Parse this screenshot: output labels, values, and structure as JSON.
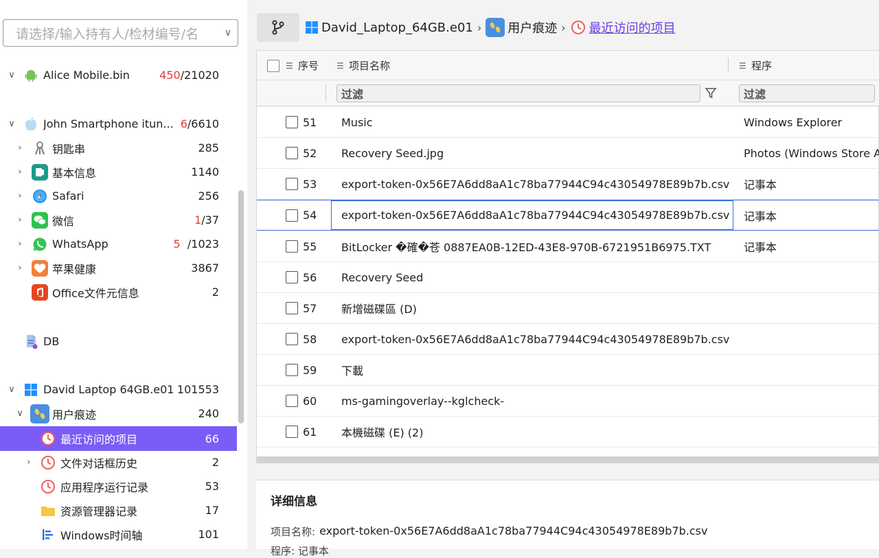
{
  "sidebar": {
    "owner_select_placeholder": "请选择/输入持有人/检材编号/名",
    "nodes": [
      {
        "label": "Alice Mobile.bin",
        "count_red": "450",
        "count_rest": "/21020"
      },
      {
        "label": "John Smartphone itun...",
        "count_red": "6",
        "count_rest": "/6610"
      },
      {
        "label": "钥匙串",
        "count_red": "",
        "count_rest": "285"
      },
      {
        "label": "基本信息",
        "count_red": "",
        "count_rest": "1140"
      },
      {
        "label": "Safari",
        "count_red": "",
        "count_rest": "256"
      },
      {
        "label": "微信",
        "count_red": "1",
        "count_rest": "/37"
      },
      {
        "label": "WhatsApp",
        "count_red": "5",
        "count_rest": "/1023"
      },
      {
        "label": "苹果健康",
        "count_red": "",
        "count_rest": "3867"
      },
      {
        "label": "Office文件元信息",
        "count_red": "",
        "count_rest": "2"
      },
      {
        "label": "DB",
        "count_red": "",
        "count_rest": ""
      },
      {
        "label": "David Laptop 64GB.e01",
        "count_red": "",
        "count_rest": "101553"
      },
      {
        "label": "用户痕迹",
        "count_red": "",
        "count_rest": "240"
      },
      {
        "label": "最近访问的项目",
        "count_red": "",
        "count_rest": "66"
      },
      {
        "label": "文件对话框历史",
        "count_red": "",
        "count_rest": "2"
      },
      {
        "label": "应用程序运行记录",
        "count_red": "",
        "count_rest": "53"
      },
      {
        "label": "资源管理器记录",
        "count_red": "",
        "count_rest": "17"
      },
      {
        "label": "Windows时间轴",
        "count_red": "",
        "count_rest": "101"
      }
    ]
  },
  "breadcrumb": {
    "device": "David_Laptop_64GB.e01",
    "category": "用户痕迹",
    "current": "最近访问的项目"
  },
  "table": {
    "headers": {
      "seq": "序号",
      "name": "项目名称",
      "program": "程序"
    },
    "filter_placeholder": "过滤",
    "rows": [
      {
        "seq": "51",
        "name": "Music",
        "program": "Windows Explorer"
      },
      {
        "seq": "52",
        "name": "Recovery Seed.jpg",
        "program": "Photos (Windows Store A"
      },
      {
        "seq": "53",
        "name": "export-token-0x56E7A6dd8aA1c78ba77944C94c43054978E89b7b.csv",
        "program": "记事本"
      },
      {
        "seq": "54",
        "name": "export-token-0x56E7A6dd8aA1c78ba77944C94c43054978E89b7b.csv",
        "program": "记事本"
      },
      {
        "seq": "55",
        "name": "BitLocker �確�苍 0887EA0B-12ED-43E8-970B-6721951B6975.TXT",
        "program": "记事本"
      },
      {
        "seq": "56",
        "name": "Recovery Seed",
        "program": ""
      },
      {
        "seq": "57",
        "name": "新增磁碟區 (D)",
        "program": ""
      },
      {
        "seq": "58",
        "name": "export-token-0x56E7A6dd8aA1c78ba77944C94c43054978E89b7b.csv",
        "program": ""
      },
      {
        "seq": "59",
        "name": "下載",
        "program": ""
      },
      {
        "seq": "60",
        "name": "ms-gamingoverlay--kglcheck-",
        "program": ""
      },
      {
        "seq": "61",
        "name": "本機磁碟 (E) (2)",
        "program": ""
      }
    ]
  },
  "details": {
    "title": "详细信息",
    "name_key": "项目名称:",
    "name_value": "export-token-0x56E7A6dd8aA1c78ba77944C94c43054978E89b7b.csv",
    "program_key": "程序:",
    "program_value": "记事本"
  },
  "colors": {
    "accent": "#7b5cf6",
    "link": "#6a3ee0",
    "red": "#e23b3b",
    "focus": "#2f6fe0"
  }
}
